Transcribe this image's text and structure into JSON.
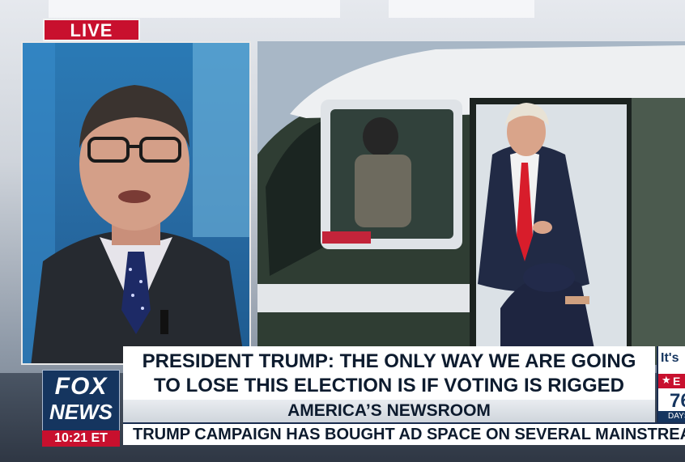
{
  "live_bug": "LIVE",
  "headline": {
    "line1": "PRESIDENT TRUMP: THE ONLY WAY WE ARE GOING",
    "line2": "TO LOSE THIS ELECTION IS IF VOTING IS RIGGED"
  },
  "show_name": "AMERICA’S NEWSROOM",
  "ticker": "TRUMP CAMPAIGN HAS BOUGHT AD SPACE ON SEVERAL MAINSTREAM",
  "network": {
    "word1": "FOX",
    "word2": "NEWS"
  },
  "clock": "10:21 ET",
  "side_widget": {
    "top": "It's",
    "red_letter": "E",
    "number": "76",
    "label": "DAYS"
  },
  "icons": {
    "star": "star-icon"
  },
  "colors": {
    "live_red": "#c8102e",
    "fox_navy": "#15355f",
    "headline_text": "#0d1b2e"
  }
}
